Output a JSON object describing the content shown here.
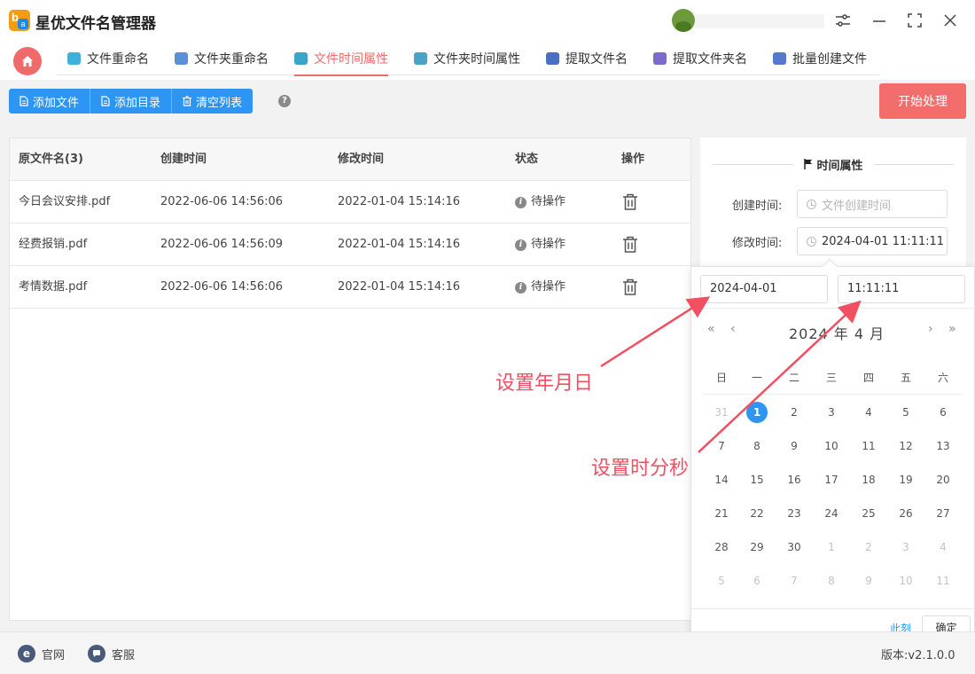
{
  "app": {
    "title": "星优文件名管理器"
  },
  "tabs": [
    {
      "label": "文件重命名",
      "icon": "rename-file-icon",
      "color": "#3fb0d8"
    },
    {
      "label": "文件夹重命名",
      "icon": "rename-folder-icon",
      "color": "#5b8fd6"
    },
    {
      "label": "文件时间属性",
      "icon": "file-time-icon",
      "color": "#3aa5c9",
      "active": true
    },
    {
      "label": "文件夹时间属性",
      "icon": "folder-time-icon",
      "color": "#49a3c7"
    },
    {
      "label": "提取文件名",
      "icon": "extract-filename-icon",
      "color": "#4a6fc2"
    },
    {
      "label": "提取文件夹名",
      "icon": "extract-foldername-icon",
      "color": "#7e6ac9"
    },
    {
      "label": "批量创建文件",
      "icon": "batch-create-icon",
      "color": "#5679cc"
    }
  ],
  "toolbar": {
    "add_file": "添加文件",
    "add_dir": "添加目录",
    "clear_list": "清空列表",
    "help": "?",
    "start": "开始处理"
  },
  "table": {
    "headers": [
      "原文件名(3)",
      "创建时间",
      "修改时间",
      "状态",
      "操作"
    ],
    "rows": [
      {
        "name": "今日会议安排.pdf",
        "created": "2022-06-06 14:56:06",
        "modified": "2022-01-04 15:14:16",
        "status": "待操作"
      },
      {
        "name": "经费报销.pdf",
        "created": "2022-06-06 14:56:09",
        "modified": "2022-01-04 15:14:16",
        "status": "待操作"
      },
      {
        "name": "考情数据.pdf",
        "created": "2022-06-06 14:56:06",
        "modified": "2022-01-04 15:14:16",
        "status": "待操作"
      }
    ]
  },
  "panel": {
    "heading": "时间属性",
    "created_label": "创建时间:",
    "created_placeholder": "文件创建时间",
    "modified_label": "修改时间:",
    "modified_value": "2024-04-01 11:11:11"
  },
  "picker": {
    "date_value": "2024-04-01",
    "time_value": "11:11:11",
    "year_month": "2024 年  4 月",
    "weekdays": [
      "日",
      "一",
      "二",
      "三",
      "四",
      "五",
      "六"
    ],
    "weeks": [
      [
        "31",
        "1",
        "2",
        "3",
        "4",
        "5",
        "6"
      ],
      [
        "7",
        "8",
        "9",
        "10",
        "11",
        "12",
        "13"
      ],
      [
        "14",
        "15",
        "16",
        "17",
        "18",
        "19",
        "20"
      ],
      [
        "21",
        "22",
        "23",
        "24",
        "25",
        "26",
        "27"
      ],
      [
        "28",
        "29",
        "30",
        "1",
        "2",
        "3",
        "4"
      ],
      [
        "5",
        "6",
        "7",
        "8",
        "9",
        "10",
        "11"
      ]
    ],
    "selected_day": "1",
    "now_label": "此刻",
    "ok_label": "确定",
    "nav": {
      "prev_year": "«",
      "prev_month": "‹",
      "next_month": "›",
      "next_year": "»"
    }
  },
  "annotations": {
    "set_date": "设置年月日",
    "set_time": "设置时分秒"
  },
  "footer": {
    "website": "官网",
    "support": "客服",
    "version": "版本:v2.1.0.0"
  },
  "colors": {
    "accent": "#f06a6a",
    "primary": "#2d96f5",
    "annotation": "#f24f62"
  }
}
